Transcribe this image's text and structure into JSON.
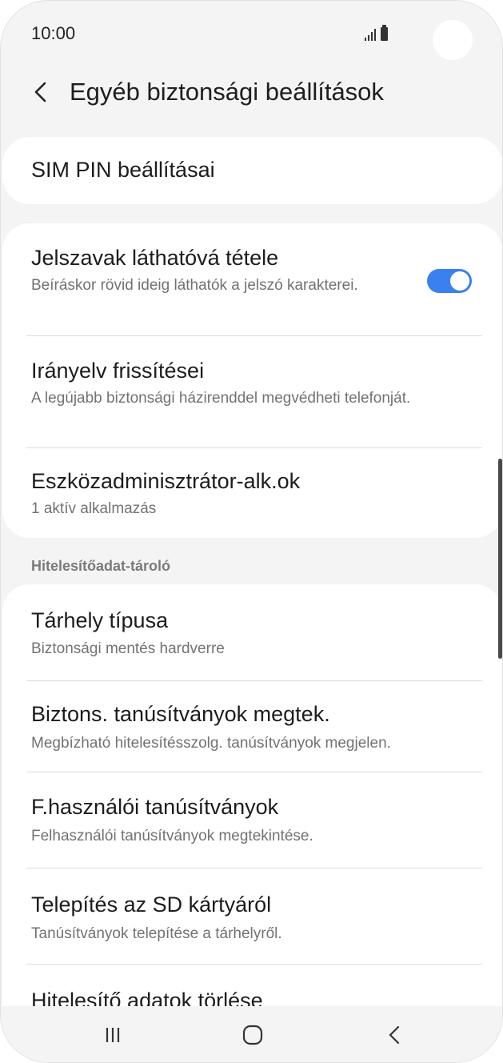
{
  "status_bar": {
    "time": "10:00",
    "icons": [
      "signal-icon",
      "battery-icon"
    ]
  },
  "header": {
    "back_icon": "chevron-left-icon",
    "title": "Egyéb biztonsági beállítások"
  },
  "sim_card": {
    "title": "SIM PIN beállításai"
  },
  "main_list": {
    "items": [
      {
        "title": "Jelszavak láthatóvá tétele",
        "subtitle": "Beíráskor rövid ideig láthatók a jelszó karakterei.",
        "toggle_on": true
      },
      {
        "title": "Irányelv frissítései",
        "subtitle": "A legújabb biztonsági házirenddel megvédheti telefonját."
      },
      {
        "title": "Eszközadminisztrátor-alk.ok",
        "subtitle": "1 aktív alkalmazás"
      }
    ]
  },
  "credential_section": {
    "header": "Hitelesítőadat-tároló",
    "items": [
      {
        "title": "Tárhely típusa",
        "subtitle": "Biztonsági mentés hardverre"
      },
      {
        "title": "Biztons. tanúsítványok megtek.",
        "subtitle": "Megbízható hitelesítésszolg. tanúsítványok megjelen."
      },
      {
        "title": "F.használói tanúsítványok",
        "subtitle": "Felhasználói tanúsítványok megtekintése."
      },
      {
        "title": "Telepítés az SD kártyáról",
        "subtitle": "Tanúsítványok telepítése a tárhelyről."
      },
      {
        "title": "Hitelesítő adatok törlése"
      }
    ]
  },
  "nav_bar": {
    "buttons": [
      "recent-apps-icon",
      "home-icon",
      "back-icon"
    ]
  },
  "colors": {
    "accent": "#3b80ef",
    "background": "#f4f4f4",
    "card": "#ffffff",
    "subtitle": "#727272"
  }
}
